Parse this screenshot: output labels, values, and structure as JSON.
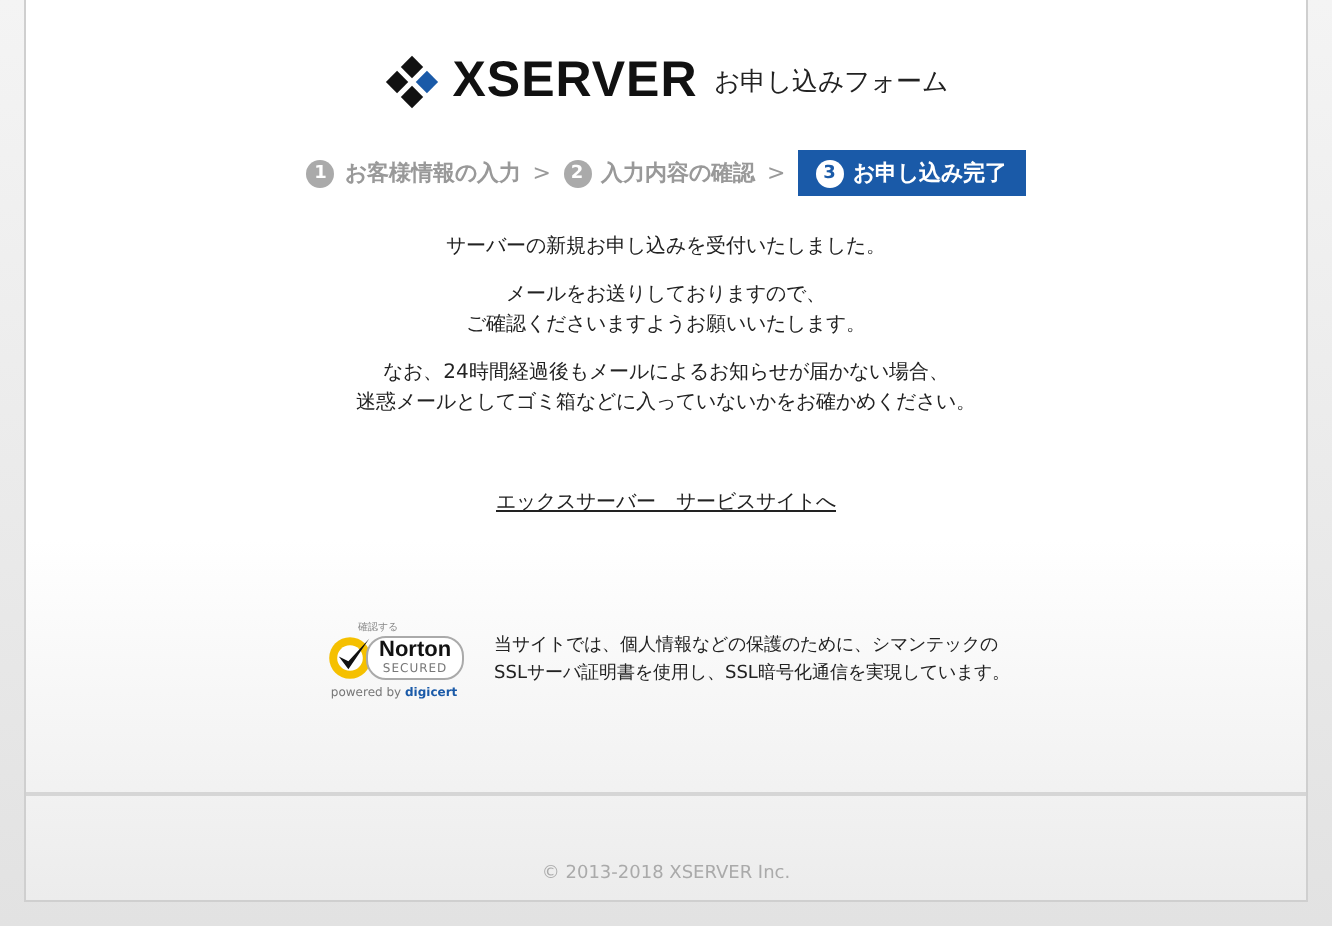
{
  "header": {
    "logo": "XSERVER",
    "form_title": "お申し込みフォーム"
  },
  "steps": [
    {
      "number": "1",
      "label": "お客様情報の入力",
      "selected": false
    },
    {
      "number": "2",
      "label": "入力内容の確認",
      "selected": false
    },
    {
      "number": "3",
      "label": "お申し込み完了",
      "selected": true
    }
  ],
  "separator": ">",
  "messages": [
    {
      "lines": [
        "サーバーの新規お申し込みを受付いたしました。"
      ]
    },
    {
      "lines": [
        "メールをお送りしておりますので、",
        "ご確認くださいますようお願いいたします。"
      ]
    },
    {
      "lines": [
        "なお、24時間経過後もメールによるお知らせが届かない場合、",
        "迷惑メールとしてゴミ箱などに入っていないかをお確かめください。"
      ]
    }
  ],
  "link": "エックスサーバー　サービスサイトへ",
  "seal": {
    "caption": "確認する",
    "brand": "Norton",
    "status": "SECURED",
    "powered": "powered by",
    "partner": "digicert"
  },
  "seal_text": [
    "当サイトでは、個人情報などの保護のために、シマンテックの",
    "SSLサーバ証明書を使用し、SSL暗号化通信を実現しています。"
  ],
  "footer": "© 2013-2018 XSERVER Inc."
}
